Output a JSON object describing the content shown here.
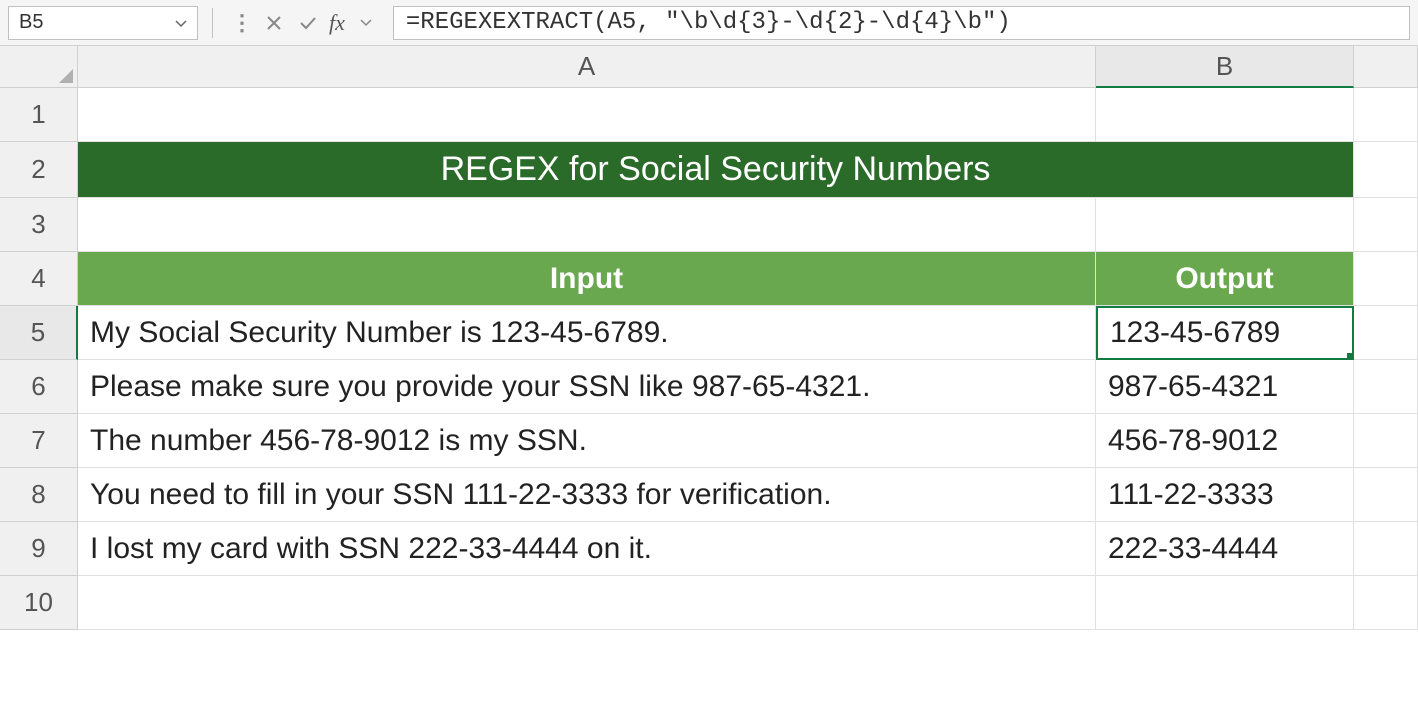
{
  "formula_bar": {
    "cell_ref": "B5",
    "formula": "=REGEXEXTRACT(A5, \"\\b\\d{3}-\\d{2}-\\d{4}\\b\")"
  },
  "columns": {
    "A": "A",
    "B": "B"
  },
  "row_labels": [
    "1",
    "2",
    "3",
    "4",
    "5",
    "6",
    "7",
    "8",
    "9",
    "10"
  ],
  "title": "REGEX for Social Security Numbers",
  "headers": {
    "input": "Input",
    "output": "Output"
  },
  "data": [
    {
      "input": "My Social Security Number is 123-45-6789.",
      "output": "123-45-6789"
    },
    {
      "input": "Please make sure you provide your SSN like 987-65-4321.",
      "output": "987-65-4321"
    },
    {
      "input": "The number 456-78-9012 is my SSN.",
      "output": "456-78-9012"
    },
    {
      "input": "You need to fill in your SSN 111-22-3333 for verification.",
      "output": "111-22-3333"
    },
    {
      "input": "I lost my card with SSN 222-33-4444 on it.",
      "output": "222-33-4444"
    }
  ],
  "selected_cell": "B5"
}
